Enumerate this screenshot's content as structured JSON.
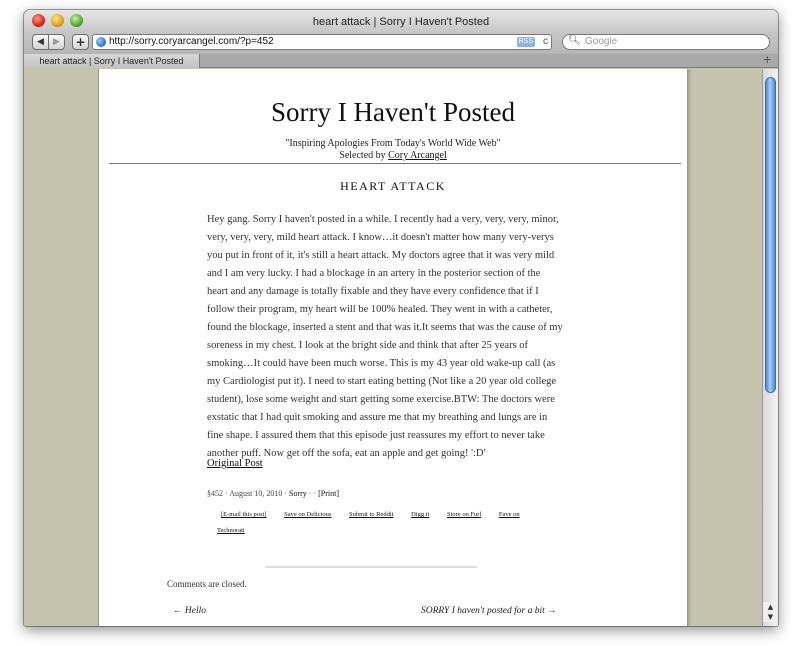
{
  "window": {
    "title": "heart attack | Sorry I Haven't Posted"
  },
  "toolbar": {
    "back_icon": "◀",
    "forward_icon": "▶",
    "add_icon": "+",
    "url": "http://sorry.coryarcangel.com/?p=452",
    "rss_label": "RSS",
    "reload_icon": "c",
    "search_placeholder": "Google"
  },
  "tabs": [
    {
      "label": "heart attack | Sorry I Haven't Posted"
    }
  ],
  "site": {
    "title": "Sorry I Haven't Posted",
    "tagline": "\"Inspiring Apologies From Today's World Wide Web\"",
    "selected_by_prefix": "Selected by",
    "selected_by_name": "Cory Arcangel"
  },
  "post": {
    "title": "HEART ATTACK",
    "body": "Hey gang. Sorry I haven't posted in a while. I recently had a very, very, very, minor, very, very, very, mild heart attack. I know…it doesn't matter how many very-verys you put in front of it, it's still a heart attack. My doctors agree that it was very mild and I am very lucky. I had a blockage in an artery in the posterior section of the heart and any damage is totally fixable and they have every confidence that if I follow their program, my heart will be 100% healed. They went in with a catheter, found the blockage, inserted a stent and that was it.It seems that was the cause of my soreness in my chest. I look at the bright side and think that after 25 years of smoking…It could have been much worse. This is my 43 year old wake-up call (as my Cardiologist put it). I need to start eating betting (Not like a 20 year old college student), lose some weight and start getting some exercise.BTW: The doctors were exstatic that I had quit smoking and assure me that my breathing and lungs are in fine shape. I assured them that this episode just reassures my effort to never take another puff. Now get off the sofa, eat an apple and get going! ':D'",
    "original_link": "Original Post",
    "meta_prefix": "§452 · August 10, 2010 ·",
    "meta_category": "Sorry",
    "meta_sep": "· ·",
    "meta_print": "[Print]",
    "share_links": [
      "[E-mail this post]",
      "Save on Delicious",
      "Submit to Reddit",
      "Digg it",
      "Store on Furl",
      "Fave on Technorati"
    ]
  },
  "comments": {
    "closed_text": "Comments are closed."
  },
  "navigation": {
    "prev": "← Hello",
    "next": "SORRY I haven't posted for a bit →"
  },
  "colors": {
    "window_background": "#c5c2ae",
    "scroll_thumb": "#4a86d8"
  }
}
